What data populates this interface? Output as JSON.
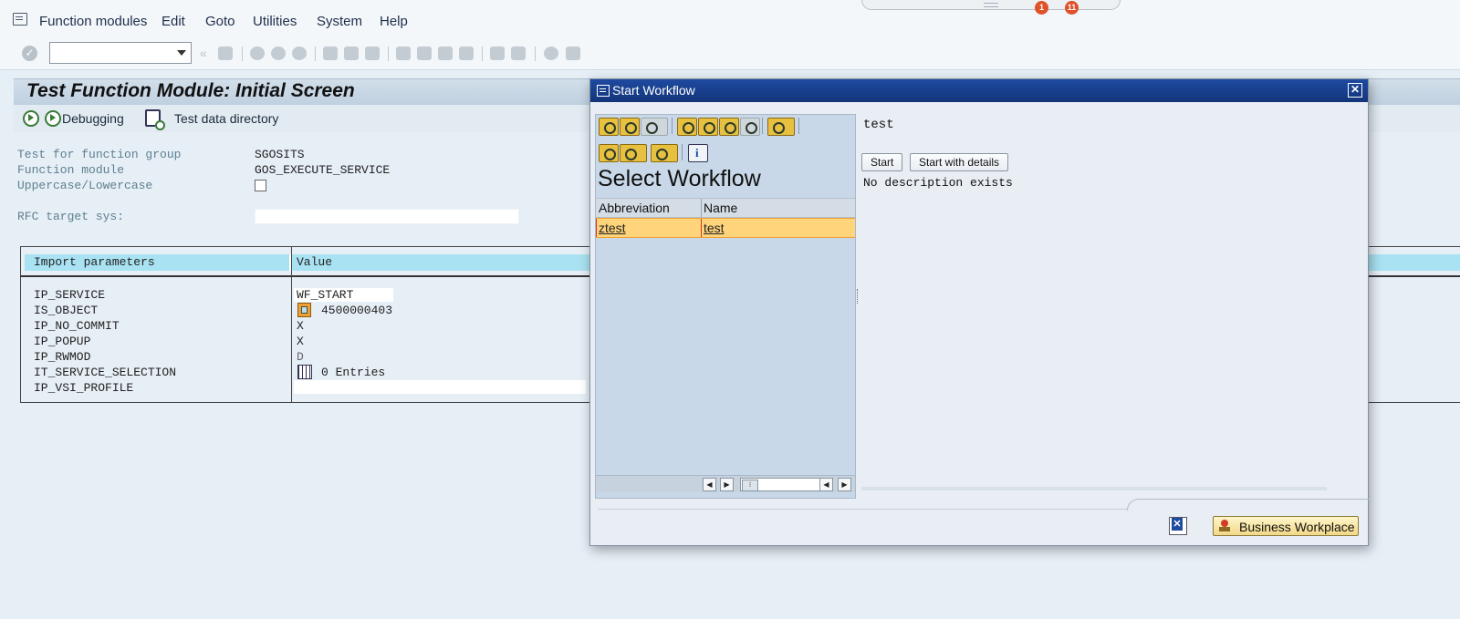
{
  "menu": {
    "items": [
      "Function modules",
      "Edit",
      "Goto",
      "Utilities",
      "System",
      "Help"
    ],
    "badges": [
      "1",
      "11"
    ]
  },
  "toolbar": {
    "command_field_value": ""
  },
  "screen": {
    "title": "Test Function Module: Initial Screen",
    "app_toolbar": {
      "debugging_label": "Debugging",
      "test_data_directory_label": "Test data directory"
    },
    "fields": {
      "function_group_label": "Test for function group",
      "function_group_value": "SGOSITS",
      "function_module_label": "Function module",
      "function_module_value": "GOS_EXECUTE_SERVICE",
      "case_label": "Uppercase/Lowercase",
      "case_checked": false,
      "rfc_label": "RFC target sys:",
      "rfc_value": ""
    },
    "params": {
      "header_import": "Import parameters",
      "header_value": "Value",
      "rows": [
        {
          "name": "IP_SERVICE",
          "value": "WF_START"
        },
        {
          "name": "IS_OBJECT",
          "value": "4500000403"
        },
        {
          "name": "IP_NO_COMMIT",
          "value": "X"
        },
        {
          "name": "IP_POPUP",
          "value": "X"
        },
        {
          "name": "IP_RWMOD",
          "value": "D"
        },
        {
          "name": "IT_SERVICE_SELECTION",
          "value": "0 Entries"
        },
        {
          "name": "IP_VSI_PROFILE",
          "value": ""
        }
      ]
    }
  },
  "dialog": {
    "title": "Start Workflow",
    "left_pane": {
      "title": "Select Workflow",
      "columns": [
        "Abbreviation",
        "Name"
      ],
      "rows": [
        {
          "abbreviation": "ztest",
          "name": "test"
        }
      ]
    },
    "right_pane": {
      "title": "test",
      "start_label": "Start",
      "start_details_label": "Start with details",
      "description": "No description exists"
    },
    "footer": {
      "business_workplace_label": "Business Workplace"
    }
  },
  "colors": {
    "dialog_title_bar": "#1e4aa0",
    "selected_row": "#ffd47a",
    "param_header": "#a9e2f2"
  }
}
